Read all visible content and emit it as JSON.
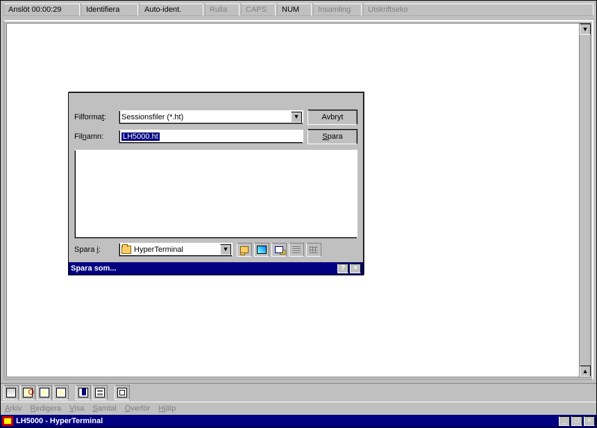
{
  "window": {
    "title": "LH5000 - HyperTerminal"
  },
  "menu": {
    "arkiv": "Arkiv",
    "redigera": "Redigera",
    "visa": "Visa",
    "samtal": "Samtal",
    "overfor": "Överför",
    "hjalp": "Hjälp"
  },
  "dialog": {
    "title": "Spara som...",
    "save_in_label": "Spara i:",
    "save_in_value": "HyperTerminal",
    "filename_label": "Filnamn:",
    "filename_value": "LH5000.ht",
    "filetype_label": "Filformat:",
    "filetype_value": "Sessionsfiler (*.ht)",
    "save_btn": "Spara",
    "cancel_btn": "Avbryt"
  },
  "status": {
    "connected": "Anslöt 00:00:29",
    "detect": "Identifiera",
    "auto": "Auto-ident.",
    "rulla": "Rulla",
    "caps": "CAPS",
    "num": "NUM",
    "insamling": "Insamling",
    "utskrift": "Utskriftseko"
  }
}
